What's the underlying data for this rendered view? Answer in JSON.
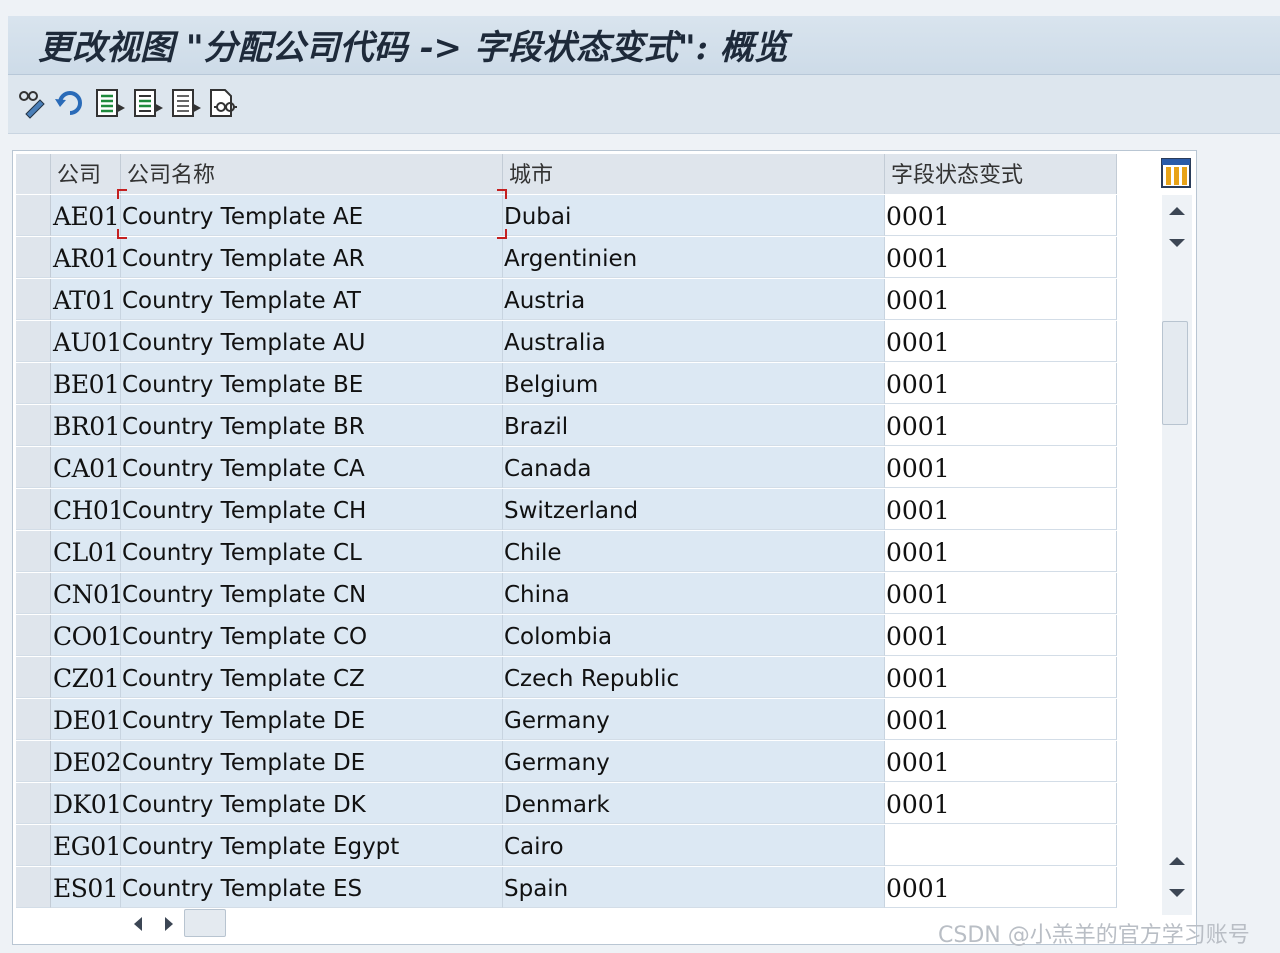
{
  "window": {
    "title": "更改视图 \"分配公司代码 -> 字段状态变式\": 概览"
  },
  "toolbar": {
    "buttons": [
      {
        "name": "display-change-icon"
      },
      {
        "name": "undo-icon"
      },
      {
        "name": "select-all-icon"
      },
      {
        "name": "select-block-icon"
      },
      {
        "name": "deselect-all-icon"
      },
      {
        "name": "print-preview-icon"
      }
    ]
  },
  "table": {
    "columns": [
      "公司",
      "公司名称",
      "城市",
      "字段状态变式"
    ],
    "rows": [
      {
        "code": "AE01",
        "name": "Country Template AE",
        "city": "Dubai",
        "variant": "0001"
      },
      {
        "code": "AR01",
        "name": "Country Template AR",
        "city": "Argentinien",
        "variant": "0001"
      },
      {
        "code": "AT01",
        "name": "Country Template AT",
        "city": "Austria",
        "variant": "0001"
      },
      {
        "code": "AU01",
        "name": "Country Template AU",
        "city": "Australia",
        "variant": "0001"
      },
      {
        "code": "BE01",
        "name": "Country Template BE",
        "city": "Belgium",
        "variant": "0001"
      },
      {
        "code": "BR01",
        "name": "Country Template BR",
        "city": "Brazil",
        "variant": "0001"
      },
      {
        "code": "CA01",
        "name": "Country Template CA",
        "city": "Canada",
        "variant": "0001"
      },
      {
        "code": "CH01",
        "name": "Country Template CH",
        "city": "Switzerland",
        "variant": "0001"
      },
      {
        "code": "CL01",
        "name": "Country Template CL",
        "city": "Chile",
        "variant": "0001"
      },
      {
        "code": "CN01",
        "name": "Country Template CN",
        "city": "China",
        "variant": "0001"
      },
      {
        "code": "CO01",
        "name": "Country Template CO",
        "city": "Colombia",
        "variant": "0001"
      },
      {
        "code": "CZ01",
        "name": "Country Template CZ",
        "city": "Czech Republic",
        "variant": "0001"
      },
      {
        "code": "DE01",
        "name": "Country Template DE",
        "city": "Germany",
        "variant": "0001"
      },
      {
        "code": "DE02",
        "name": "Country Template DE",
        "city": "Germany",
        "variant": "0001"
      },
      {
        "code": "DK01",
        "name": "Country Template DK",
        "city": "Denmark",
        "variant": "0001"
      },
      {
        "code": "EG01",
        "name": "Country Template Egypt",
        "city": "Cairo",
        "variant": ""
      },
      {
        "code": "ES01",
        "name": "Country Template ES",
        "city": "Spain",
        "variant": "0001"
      }
    ]
  },
  "watermark": "CSDN @小羔羊的官方学习账号",
  "colors": {
    "editable_cell": "#ffffff",
    "readonly_cell": "#dce8f3",
    "header": "#dfe5ec",
    "focus_marker": "#c42020"
  }
}
